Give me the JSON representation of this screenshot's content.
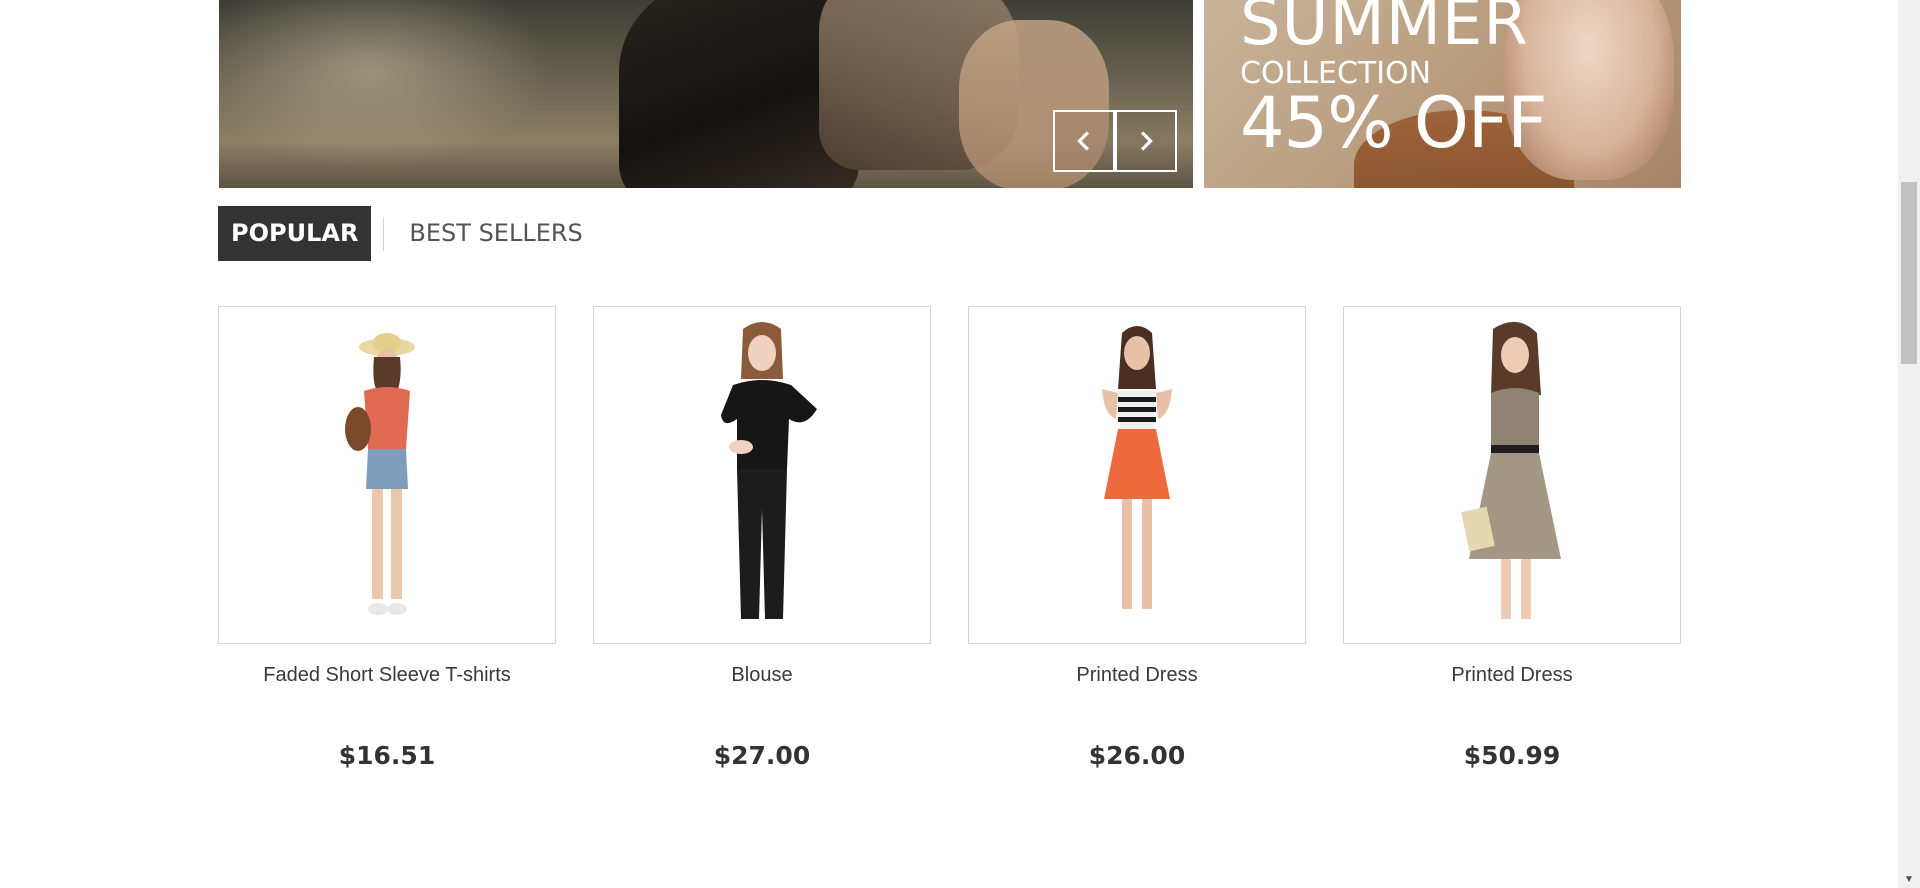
{
  "banner": {
    "prev_icon": "chevron-left-icon",
    "next_icon": "chevron-right-icon",
    "promo_line1": "SUMMER",
    "promo_line2": "COLLECTION",
    "promo_line3": "45% OFF"
  },
  "tabs": [
    {
      "label": "POPULAR",
      "active": true
    },
    {
      "label": "BEST SELLERS",
      "active": false
    }
  ],
  "products": [
    {
      "name": "Faded Short Sleeve T-shirts",
      "price": "$16.51"
    },
    {
      "name": "Blouse",
      "price": "$27.00"
    },
    {
      "name": "Printed Dress",
      "price": "$26.00"
    },
    {
      "name": "Printed Dress",
      "price": "$50.99"
    }
  ],
  "colors": {
    "tab_active_bg": "#333333",
    "tab_inactive_text": "#555454",
    "border": "#d6d4d4",
    "price_text": "#333333"
  }
}
